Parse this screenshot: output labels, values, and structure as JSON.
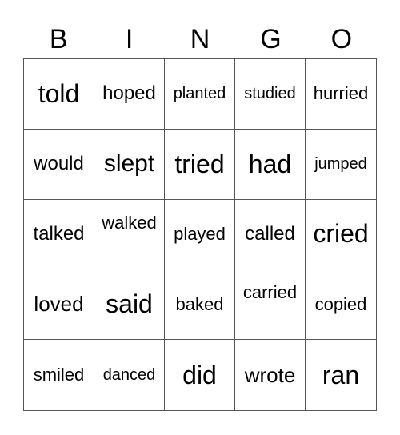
{
  "header": [
    "B",
    "I",
    "N",
    "G",
    "O"
  ],
  "cells": [
    "told",
    "hoped",
    "planted",
    "studied",
    "hurried",
    "would",
    "slept",
    "tried",
    "had",
    "jumped",
    "talked",
    "walked",
    "played",
    "called",
    "cried",
    "loved",
    "said",
    "baked",
    "carried",
    "copied",
    "smiled",
    "danced",
    "did",
    "wrote",
    "ran"
  ]
}
